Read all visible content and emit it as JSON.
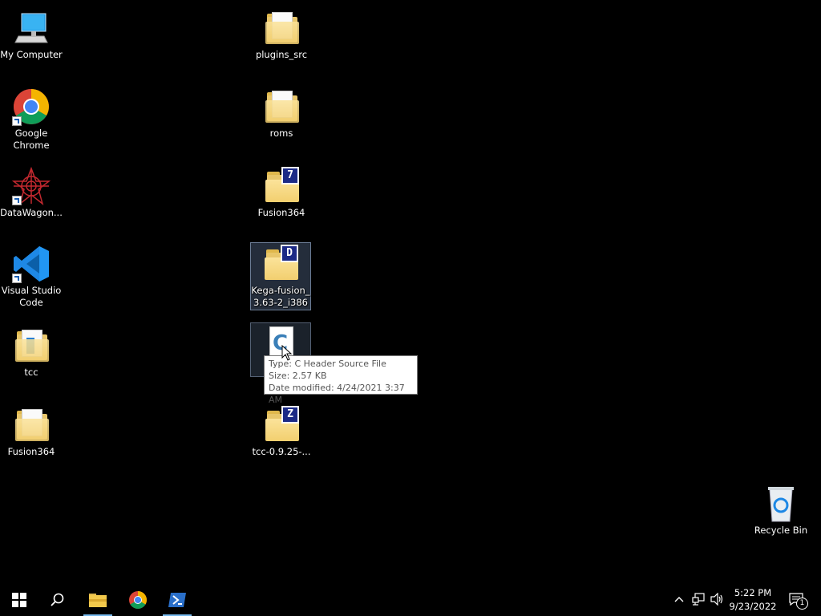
{
  "desktop": {
    "icons_left": [
      {
        "label": "My Computer"
      },
      {
        "label": "Google Chrome"
      },
      {
        "label": "DataWagon..."
      },
      {
        "label": "Visual Studio Code"
      },
      {
        "label": "tcc"
      },
      {
        "label": "Fusion364"
      }
    ],
    "icons_mid": [
      {
        "label": "plugins_src"
      },
      {
        "label": "roms"
      },
      {
        "label": "Fusion364",
        "badge": "7"
      },
      {
        "label": "Kega-fusion_ 3.63-2_i386",
        "badge": "D"
      },
      {
        "label": "",
        "glyph": "C"
      },
      {
        "label": "tcc-0.9.25-...",
        "badge": "Z"
      }
    ],
    "recycle_bin": {
      "label": "Recycle Bin"
    }
  },
  "tooltip": {
    "type": "Type: C Header Source File",
    "size": "Size: 2.57 KB",
    "date": "Date modified: 4/24/2021 3:37 AM"
  },
  "taskbar": {
    "time": "5:22 PM",
    "date": "9/23/2022",
    "notification_count": "1"
  },
  "colors": {
    "taskbar_accent": "#76b9ed",
    "archive_badge": "#1c2a86"
  }
}
